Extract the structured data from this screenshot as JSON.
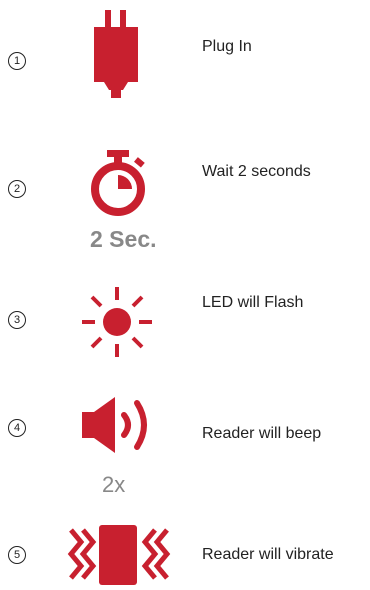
{
  "accent_color": "#C8202F",
  "steps": [
    {
      "number": "1",
      "icon": "plug-icon",
      "label": "Plug In"
    },
    {
      "number": "2",
      "icon": "stopwatch-icon",
      "label": "Wait 2 seconds",
      "subtext": "2 Sec."
    },
    {
      "number": "3",
      "icon": "sun-flash-icon",
      "label": "LED will Flash"
    },
    {
      "number": "4",
      "icon": "speaker-icon",
      "label": "Reader will beep",
      "subtext": "2x"
    },
    {
      "number": "5",
      "icon": "vibrate-icon",
      "label": "Reader will vibrate"
    }
  ]
}
